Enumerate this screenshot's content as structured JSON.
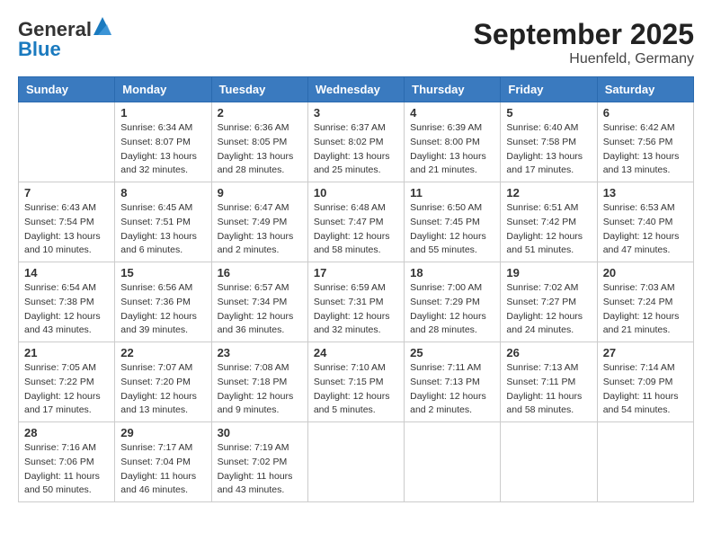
{
  "logo": {
    "general": "General",
    "blue": "Blue"
  },
  "title": "September 2025",
  "subtitle": "Huenfeld, Germany",
  "weekdays": [
    "Sunday",
    "Monday",
    "Tuesday",
    "Wednesday",
    "Thursday",
    "Friday",
    "Saturday"
  ],
  "weeks": [
    [
      {
        "day": "",
        "info": ""
      },
      {
        "day": "1",
        "info": "Sunrise: 6:34 AM\nSunset: 8:07 PM\nDaylight: 13 hours\nand 32 minutes."
      },
      {
        "day": "2",
        "info": "Sunrise: 6:36 AM\nSunset: 8:05 PM\nDaylight: 13 hours\nand 28 minutes."
      },
      {
        "day": "3",
        "info": "Sunrise: 6:37 AM\nSunset: 8:02 PM\nDaylight: 13 hours\nand 25 minutes."
      },
      {
        "day": "4",
        "info": "Sunrise: 6:39 AM\nSunset: 8:00 PM\nDaylight: 13 hours\nand 21 minutes."
      },
      {
        "day": "5",
        "info": "Sunrise: 6:40 AM\nSunset: 7:58 PM\nDaylight: 13 hours\nand 17 minutes."
      },
      {
        "day": "6",
        "info": "Sunrise: 6:42 AM\nSunset: 7:56 PM\nDaylight: 13 hours\nand 13 minutes."
      }
    ],
    [
      {
        "day": "7",
        "info": "Sunrise: 6:43 AM\nSunset: 7:54 PM\nDaylight: 13 hours\nand 10 minutes."
      },
      {
        "day": "8",
        "info": "Sunrise: 6:45 AM\nSunset: 7:51 PM\nDaylight: 13 hours\nand 6 minutes."
      },
      {
        "day": "9",
        "info": "Sunrise: 6:47 AM\nSunset: 7:49 PM\nDaylight: 13 hours\nand 2 minutes."
      },
      {
        "day": "10",
        "info": "Sunrise: 6:48 AM\nSunset: 7:47 PM\nDaylight: 12 hours\nand 58 minutes."
      },
      {
        "day": "11",
        "info": "Sunrise: 6:50 AM\nSunset: 7:45 PM\nDaylight: 12 hours\nand 55 minutes."
      },
      {
        "day": "12",
        "info": "Sunrise: 6:51 AM\nSunset: 7:42 PM\nDaylight: 12 hours\nand 51 minutes."
      },
      {
        "day": "13",
        "info": "Sunrise: 6:53 AM\nSunset: 7:40 PM\nDaylight: 12 hours\nand 47 minutes."
      }
    ],
    [
      {
        "day": "14",
        "info": "Sunrise: 6:54 AM\nSunset: 7:38 PM\nDaylight: 12 hours\nand 43 minutes."
      },
      {
        "day": "15",
        "info": "Sunrise: 6:56 AM\nSunset: 7:36 PM\nDaylight: 12 hours\nand 39 minutes."
      },
      {
        "day": "16",
        "info": "Sunrise: 6:57 AM\nSunset: 7:34 PM\nDaylight: 12 hours\nand 36 minutes."
      },
      {
        "day": "17",
        "info": "Sunrise: 6:59 AM\nSunset: 7:31 PM\nDaylight: 12 hours\nand 32 minutes."
      },
      {
        "day": "18",
        "info": "Sunrise: 7:00 AM\nSunset: 7:29 PM\nDaylight: 12 hours\nand 28 minutes."
      },
      {
        "day": "19",
        "info": "Sunrise: 7:02 AM\nSunset: 7:27 PM\nDaylight: 12 hours\nand 24 minutes."
      },
      {
        "day": "20",
        "info": "Sunrise: 7:03 AM\nSunset: 7:24 PM\nDaylight: 12 hours\nand 21 minutes."
      }
    ],
    [
      {
        "day": "21",
        "info": "Sunrise: 7:05 AM\nSunset: 7:22 PM\nDaylight: 12 hours\nand 17 minutes."
      },
      {
        "day": "22",
        "info": "Sunrise: 7:07 AM\nSunset: 7:20 PM\nDaylight: 12 hours\nand 13 minutes."
      },
      {
        "day": "23",
        "info": "Sunrise: 7:08 AM\nSunset: 7:18 PM\nDaylight: 12 hours\nand 9 minutes."
      },
      {
        "day": "24",
        "info": "Sunrise: 7:10 AM\nSunset: 7:15 PM\nDaylight: 12 hours\nand 5 minutes."
      },
      {
        "day": "25",
        "info": "Sunrise: 7:11 AM\nSunset: 7:13 PM\nDaylight: 12 hours\nand 2 minutes."
      },
      {
        "day": "26",
        "info": "Sunrise: 7:13 AM\nSunset: 7:11 PM\nDaylight: 11 hours\nand 58 minutes."
      },
      {
        "day": "27",
        "info": "Sunrise: 7:14 AM\nSunset: 7:09 PM\nDaylight: 11 hours\nand 54 minutes."
      }
    ],
    [
      {
        "day": "28",
        "info": "Sunrise: 7:16 AM\nSunset: 7:06 PM\nDaylight: 11 hours\nand 50 minutes."
      },
      {
        "day": "29",
        "info": "Sunrise: 7:17 AM\nSunset: 7:04 PM\nDaylight: 11 hours\nand 46 minutes."
      },
      {
        "day": "30",
        "info": "Sunrise: 7:19 AM\nSunset: 7:02 PM\nDaylight: 11 hours\nand 43 minutes."
      },
      {
        "day": "",
        "info": ""
      },
      {
        "day": "",
        "info": ""
      },
      {
        "day": "",
        "info": ""
      },
      {
        "day": "",
        "info": ""
      }
    ]
  ]
}
